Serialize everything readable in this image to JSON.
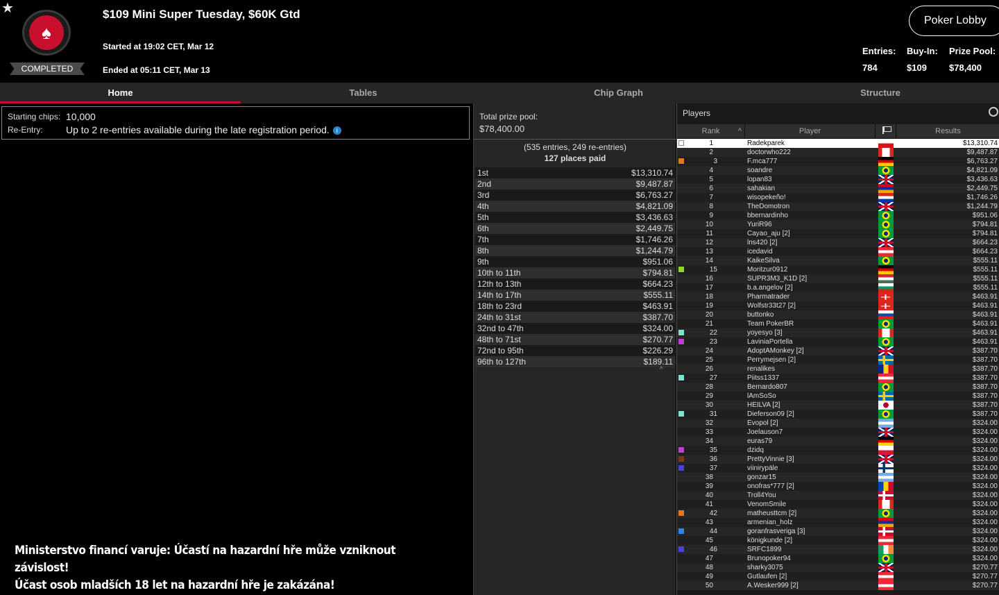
{
  "header": {
    "title": "$109 Mini Super Tuesday, $60K Gtd",
    "started": "Started at 19:02 CET, Mar 12",
    "ended": "Ended at 05:11 CET, Mar 13",
    "status": "COMPLETED",
    "lobby_button": "Poker Lobby",
    "entries_label": "Entries:",
    "entries_value": "784",
    "buyin_label": "Buy-In:",
    "buyin_value": "$109",
    "prizepool_label": "Prize Pool:",
    "prizepool_value": "$78,400"
  },
  "tabs": [
    "Home",
    "Tables",
    "Chip Graph",
    "Structure"
  ],
  "info": {
    "starting_chips_label": "Starting chips:",
    "starting_chips_value": "10,000",
    "reentry_label": "Re-Entry:",
    "reentry_value": "Up to 2 re-entries available during the late registration period."
  },
  "warning": {
    "line1": "Ministerstvo financí varuje: Účastí na hazardní hře může vzniknout závislost!",
    "line2": "Účast osob mladších 18 let na hazardní hře je zakázána!"
  },
  "prize": {
    "pool_label": "Total prize pool:",
    "pool_value": "$78,400.00",
    "entries_info": "(535 entries, 249 re-entries)",
    "places_paid": "127 places paid",
    "payouts": [
      [
        "1st",
        "$13,310.74"
      ],
      [
        "2nd",
        "$9,487.87"
      ],
      [
        "3rd",
        "$6,763.27"
      ],
      [
        "4th",
        "$4,821.09"
      ],
      [
        "5th",
        "$3,436.63"
      ],
      [
        "6th",
        "$2,449.75"
      ],
      [
        "7th",
        "$1,746.26"
      ],
      [
        "8th",
        "$1,244.79"
      ],
      [
        "9th",
        "$951.06"
      ],
      [
        "10th to 11th",
        "$794.81"
      ],
      [
        "12th to 13th",
        "$664.23"
      ],
      [
        "14th to 17th",
        "$555.11"
      ],
      [
        "18th to 23rd",
        "$463.91"
      ],
      [
        "24th to 31st",
        "$387.70"
      ],
      [
        "32nd to 47th",
        "$324.00"
      ],
      [
        "48th to 71st",
        "$270.77"
      ],
      [
        "72nd to 95th",
        "$226.29"
      ],
      [
        "96th to 127th",
        "$189.11"
      ]
    ]
  },
  "players": {
    "label": "Players",
    "col_rank": "Rank",
    "col_player": "Player",
    "col_results": "Results",
    "rows": [
      {
        "rank": "1",
        "name": "Radekparek",
        "result": "$13,310.74",
        "flag": "cz",
        "mark": "box"
      },
      {
        "rank": "2",
        "name": "doctorwho222",
        "result": "$9,487.87",
        "flag": "ca"
      },
      {
        "rank": "3",
        "name": "F.mca777",
        "result": "$6,763.27",
        "flag": "de",
        "mark": "#e07b1a"
      },
      {
        "rank": "4",
        "name": "soandre",
        "result": "$4,821.09",
        "flag": "br"
      },
      {
        "rank": "5",
        "name": "lopan83",
        "result": "$3,436.63",
        "flag": "gb"
      },
      {
        "rank": "6",
        "name": "sahakian",
        "result": "$2,449.75",
        "flag": "am"
      },
      {
        "rank": "7",
        "name": "wisopekeño!",
        "result": "$1,746.26",
        "flag": "py"
      },
      {
        "rank": "8",
        "name": "TheDomotron",
        "result": "$1,244.79",
        "flag": "gb"
      },
      {
        "rank": "9",
        "name": "bbernardinho",
        "result": "$951.06",
        "flag": "br"
      },
      {
        "rank": "10",
        "name": "YuriR96",
        "result": "$794.81",
        "flag": "br"
      },
      {
        "rank": "11",
        "name": "Cayao_aju [2]",
        "result": "$794.81",
        "flag": "br"
      },
      {
        "rank": "12",
        "name": "lns420 [2]",
        "result": "$664.23",
        "flag": "gb"
      },
      {
        "rank": "13",
        "name": "icedavid",
        "result": "$664.23",
        "flag": "at"
      },
      {
        "rank": "14",
        "name": "KaikeSilva",
        "result": "$555.11",
        "flag": "br"
      },
      {
        "rank": "15",
        "name": "Moritzur0912",
        "result": "$555.11",
        "flag": "de",
        "mark": "#8fd82a"
      },
      {
        "rank": "16",
        "name": "SUPR3M3_K1D [2]",
        "result": "$555.11",
        "flag": "hu"
      },
      {
        "rank": "17",
        "name": "b.a.angelov [2]",
        "result": "$555.11",
        "flag": "bg"
      },
      {
        "rank": "18",
        "name": "Pharmatrader",
        "result": "$463.91",
        "flag": "ch"
      },
      {
        "rank": "19",
        "name": "Wolfstr33t27 [2]",
        "result": "$463.91",
        "flag": "ch"
      },
      {
        "rank": "20",
        "name": "buttonko",
        "result": "$463.91",
        "flag": "sk"
      },
      {
        "rank": "21",
        "name": "Team PokerBR",
        "result": "$463.91",
        "flag": "br"
      },
      {
        "rank": "22",
        "name": "yoyesyo [3]",
        "result": "$463.91",
        "flag": "ca",
        "mark": "#7fe0d0"
      },
      {
        "rank": "23",
        "name": "LaviniaPortella",
        "result": "$463.91",
        "flag": "br",
        "mark": "#c040d0"
      },
      {
        "rank": "24",
        "name": "AdoptAMonkey [2]",
        "result": "$387.70",
        "flag": "gb"
      },
      {
        "rank": "25",
        "name": "Perrymejsen [2]",
        "result": "$387.70",
        "flag": "se"
      },
      {
        "rank": "26",
        "name": "renalikes",
        "result": "$387.70",
        "flag": "ro"
      },
      {
        "rank": "27",
        "name": "Piitss1337",
        "result": "$387.70",
        "flag": "at",
        "mark": "#7fe0d0"
      },
      {
        "rank": "28",
        "name": "Bernardo807",
        "result": "$387.70",
        "flag": "br"
      },
      {
        "rank": "29",
        "name": "lAmSoSo",
        "result": "$387.70",
        "flag": "se"
      },
      {
        "rank": "30",
        "name": "HEILVA [2]",
        "result": "$387.70",
        "flag": "jp"
      },
      {
        "rank": "31",
        "name": "Dieferson09 [2]",
        "result": "$387.70",
        "flag": "br",
        "mark": "#7fe0d0"
      },
      {
        "rank": "32",
        "name": "Evopol [2]",
        "result": "$324.00",
        "flag": "ar"
      },
      {
        "rank": "33",
        "name": "Joelauson7",
        "result": "$324.00",
        "flag": "gb"
      },
      {
        "rank": "34",
        "name": "euras79",
        "result": "$324.00",
        "flag": "de"
      },
      {
        "rank": "35",
        "name": "dzidq",
        "result": "$324.00",
        "flag": "pl",
        "mark": "#c040d0"
      },
      {
        "rank": "36",
        "name": "PrettyVinnie [3]",
        "result": "$324.00",
        "flag": "gb",
        "mark": "#7a3a1a"
      },
      {
        "rank": "37",
        "name": "viinirypäle",
        "result": "$324.00",
        "flag": "fi",
        "mark": "#4a40e0"
      },
      {
        "rank": "38",
        "name": "gonzar15",
        "result": "$324.00",
        "flag": "ar"
      },
      {
        "rank": "39",
        "name": "onofras*777 [2]",
        "result": "$324.00",
        "flag": "md"
      },
      {
        "rank": "40",
        "name": "Troll4You",
        "result": "$324.00",
        "flag": "dk"
      },
      {
        "rank": "41",
        "name": "VenomSmile",
        "result": "$324.00",
        "flag": "ca"
      },
      {
        "rank": "42",
        "name": "matheusttcm [2]",
        "result": "$324.00",
        "flag": "br",
        "mark": "#e07b1a"
      },
      {
        "rank": "43",
        "name": "armenian_holz",
        "result": "$324.00",
        "flag": "am"
      },
      {
        "rank": "44",
        "name": "goranfrasveriga [3]",
        "result": "$324.00",
        "flag": "dk",
        "mark": "#2a86e0"
      },
      {
        "rank": "45",
        "name": "königkunde [2]",
        "result": "$324.00",
        "flag": "at"
      },
      {
        "rank": "46",
        "name": "SRFC1899",
        "result": "$324.00",
        "flag": "ie",
        "mark": "#4a40e0"
      },
      {
        "rank": "47",
        "name": "Brunopoker94",
        "result": "$324.00",
        "flag": "br"
      },
      {
        "rank": "48",
        "name": "sharky3075",
        "result": "$270.77",
        "flag": "gb"
      },
      {
        "rank": "49",
        "name": "Gutlaufen [2]",
        "result": "$270.77",
        "flag": "at"
      },
      {
        "rank": "50",
        "name": "A.Wesker999 [2]",
        "result": "$270.77",
        "flag": "at"
      }
    ]
  }
}
